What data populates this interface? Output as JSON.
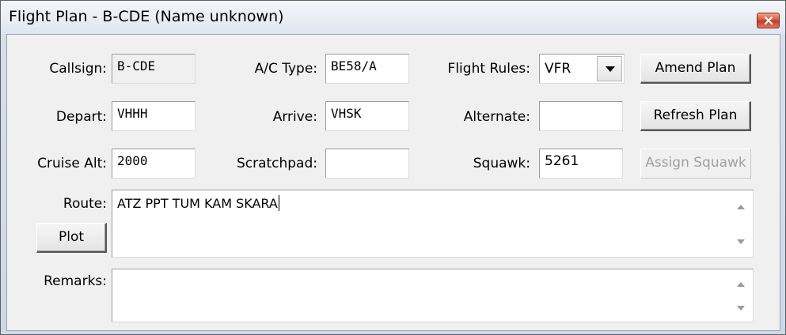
{
  "window": {
    "title": "Flight Plan - B-CDE (Name unknown)",
    "close_icon": "close-x-icon",
    "close_color": "#c8432b"
  },
  "fields": {
    "callsign": {
      "label": "Callsign:",
      "value": "B-CDE"
    },
    "ac_type": {
      "label": "A/C Type:",
      "value": "BE58/A"
    },
    "flight_rules": {
      "label": "Flight Rules:",
      "value": "VFR"
    },
    "depart": {
      "label": "Depart:",
      "value": "VHHH"
    },
    "arrive": {
      "label": "Arrive:",
      "value": "VHSK"
    },
    "alternate": {
      "label": "Alternate:",
      "value": ""
    },
    "cruise_alt": {
      "label": "Cruise Alt:",
      "value": "2000"
    },
    "scratchpad": {
      "label": "Scratchpad:",
      "value": ""
    },
    "squawk": {
      "label": "Squawk:",
      "value": "5261"
    },
    "route": {
      "label": "Route:",
      "value": "ATZ PPT TUM KAM SKARA"
    },
    "remarks": {
      "label": "Remarks:",
      "value": ""
    }
  },
  "buttons": {
    "amend_plan": "Amend Plan",
    "refresh_plan": "Refresh Plan",
    "assign_squawk": "Assign Squawk",
    "plot": "Plot"
  }
}
